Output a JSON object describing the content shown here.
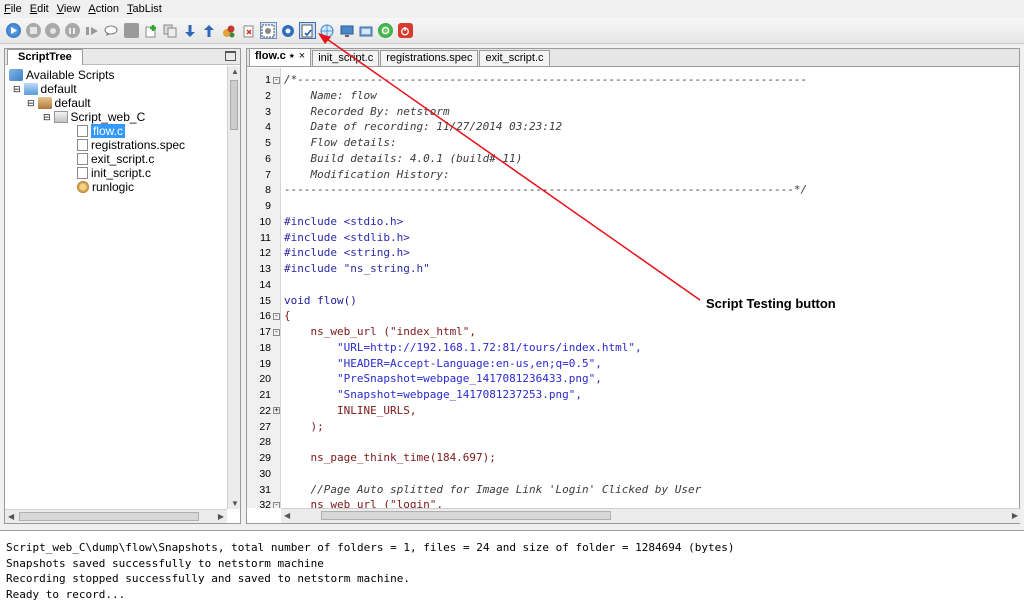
{
  "menu": [
    "File",
    "Edit",
    "View",
    "Action",
    "TabList"
  ],
  "toolbar": {
    "buttons": [
      "play-icon",
      "stop-icon",
      "record-stop-icon",
      "pause-icon",
      "step-icon",
      "comment-icon",
      "save-icon",
      "add-icon",
      "copy-icon",
      "download-icon",
      "upload-icon",
      "wizard-icon",
      "paste-icon",
      "snapshot-icon",
      "settings-icon",
      "script-testing-icon",
      "globe-icon",
      "monitor-icon",
      "screen-icon",
      "refresh-icon",
      "power-icon"
    ]
  },
  "scripttree": {
    "tab": "ScriptTree",
    "root": "Available Scripts",
    "items": [
      "default",
      "default",
      "Script_web_C",
      "flow.c",
      "registrations.spec",
      "exit_script.c",
      "init_script.c",
      "runlogic"
    ]
  },
  "editor": {
    "tabs": [
      "flow.c",
      "init_script.c",
      "registrations.spec",
      "exit_script.c"
    ],
    "tab_close": "×",
    "lines": [
      {
        "n": "1",
        "fold": "-",
        "t": "/*-----------------------------------------------------------------------------",
        "c": "c-comment"
      },
      {
        "n": "2",
        "fold": "",
        "t": "    Name: flow",
        "c": "c-comment"
      },
      {
        "n": "3",
        "fold": "",
        "t": "    Recorded By: netstorm",
        "c": "c-comment"
      },
      {
        "n": "4",
        "fold": "",
        "t": "    Date of recording: 11/27/2014 03:23:12",
        "c": "c-comment"
      },
      {
        "n": "5",
        "fold": "",
        "t": "    Flow details:",
        "c": "c-comment"
      },
      {
        "n": "6",
        "fold": "",
        "t": "    Build details: 4.0.1 (build# 11)",
        "c": "c-comment"
      },
      {
        "n": "7",
        "fold": "",
        "t": "    Modification History:",
        "c": "c-comment"
      },
      {
        "n": "8",
        "fold": "",
        "t": "-----------------------------------------------------------------------------*/",
        "c": "c-comment"
      },
      {
        "n": "9",
        "fold": "",
        "t": "",
        "c": "c-plain"
      },
      {
        "n": "10",
        "fold": "",
        "t": "#include <stdio.h>",
        "c": "c-pre"
      },
      {
        "n": "11",
        "fold": "",
        "t": "#include <stdlib.h>",
        "c": "c-pre"
      },
      {
        "n": "12",
        "fold": "",
        "t": "#include <string.h>",
        "c": "c-pre"
      },
      {
        "n": "13",
        "fold": "",
        "t": "#include \"ns_string.h\"",
        "c": "c-pre"
      },
      {
        "n": "14",
        "fold": "",
        "t": "",
        "c": "c-plain"
      },
      {
        "n": "15",
        "fold": "",
        "t": "void flow()",
        "c": "c-kw"
      },
      {
        "n": "16",
        "fold": "-",
        "t": "{",
        "c": "c-fn"
      },
      {
        "n": "17",
        "fold": "-",
        "t": "    ns_web_url (\"index_html\",",
        "c": "c-fn"
      },
      {
        "n": "18",
        "fold": "",
        "t": "        \"URL=http://192.168.1.72:81/tours/index.html\",",
        "c": "c-str"
      },
      {
        "n": "19",
        "fold": "",
        "t": "        \"HEADER=Accept-Language:en-us,en;q=0.5\",",
        "c": "c-str"
      },
      {
        "n": "20",
        "fold": "",
        "t": "        \"PreSnapshot=webpage_1417081236433.png\",",
        "c": "c-str"
      },
      {
        "n": "21",
        "fold": "",
        "t": "        \"Snapshot=webpage_1417081237253.png\",",
        "c": "c-str"
      },
      {
        "n": "22",
        "fold": "+",
        "t": "        INLINE_URLS,",
        "c": "c-fn"
      },
      {
        "n": "27",
        "fold": "",
        "t": "    );",
        "c": "c-fn"
      },
      {
        "n": "28",
        "fold": "",
        "t": "",
        "c": "c-plain"
      },
      {
        "n": "29",
        "fold": "",
        "t": "    ns_page_think_time(184.697);",
        "c": "c-fn"
      },
      {
        "n": "30",
        "fold": "",
        "t": "",
        "c": "c-plain"
      },
      {
        "n": "31",
        "fold": "",
        "t": "    //Page Auto splitted for Image Link 'Login' Clicked by User",
        "c": "c-comment"
      },
      {
        "n": "32",
        "fold": "-",
        "t": "    ns_web_url (\"login\",",
        "c": "c-fn"
      }
    ]
  },
  "console": {
    "lines": [
      "Script_web_C\\dump\\flow\\Snapshots, total number of folders = 1, files = 24 and size of folder = 1284694 (bytes)",
      "Snapshots saved successfully to netstorm machine",
      "Recording stopped successfully and saved to netstorm machine.",
      "Ready to record..."
    ]
  },
  "annotation": {
    "label": "Script Testing button",
    "color": "#e8101a"
  }
}
